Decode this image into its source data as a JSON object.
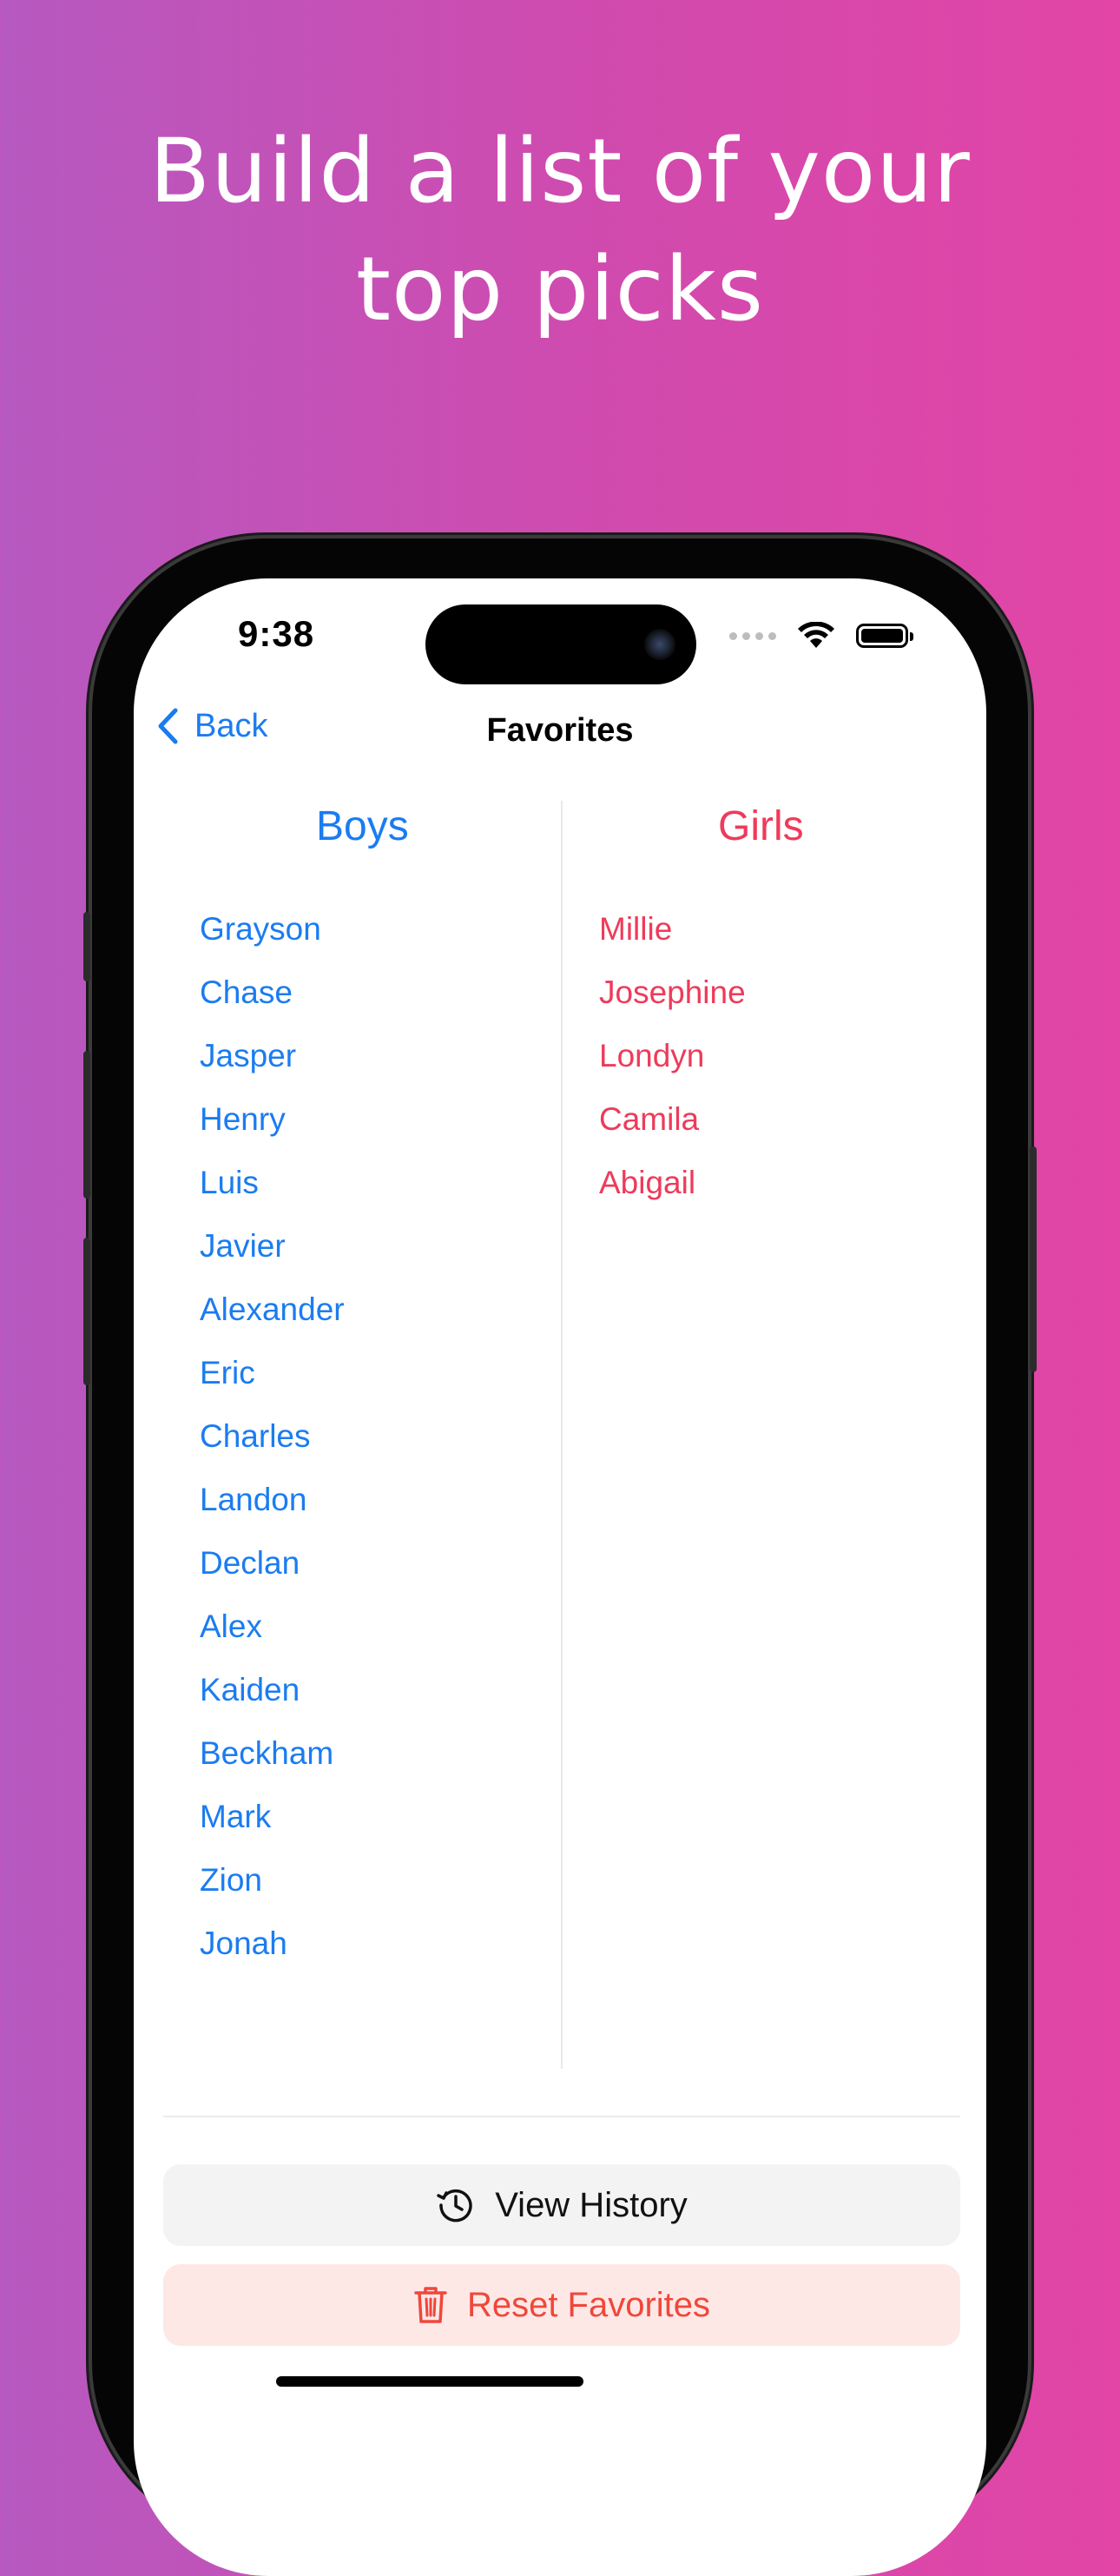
{
  "headline": {
    "line1": "Build a list of your",
    "line2": "top picks"
  },
  "status_bar": {
    "time": "9:38",
    "icons": [
      "cellular-dots-icon",
      "wifi-icon",
      "battery-icon"
    ]
  },
  "nav": {
    "back_label": "Back",
    "back_icon": "chevron-left-icon",
    "title": "Favorites"
  },
  "colors": {
    "accent_blue": "#1b7cf0",
    "accent_pink": "#ee3b5a",
    "destructive_red": "#f0473a",
    "background_gradient_start": "#b659c0",
    "background_gradient_end": "#e245a5"
  },
  "columns": {
    "boys": {
      "header": "Boys",
      "names": [
        "Grayson",
        "Chase",
        "Jasper",
        "Henry",
        "Luis",
        "Javier",
        "Alexander",
        "Eric",
        "Charles",
        "Landon",
        "Declan",
        "Alex",
        "Kaiden",
        "Beckham",
        "Mark",
        "Zion",
        "Jonah"
      ]
    },
    "girls": {
      "header": "Girls",
      "names": [
        "Millie",
        "Josephine",
        "Londyn",
        "Camila",
        "Abigail"
      ]
    }
  },
  "actions": {
    "view_history": {
      "label": "View History",
      "icon": "history-clock-icon"
    },
    "reset_favorites": {
      "label": "Reset Favorites",
      "icon": "trash-icon"
    }
  }
}
